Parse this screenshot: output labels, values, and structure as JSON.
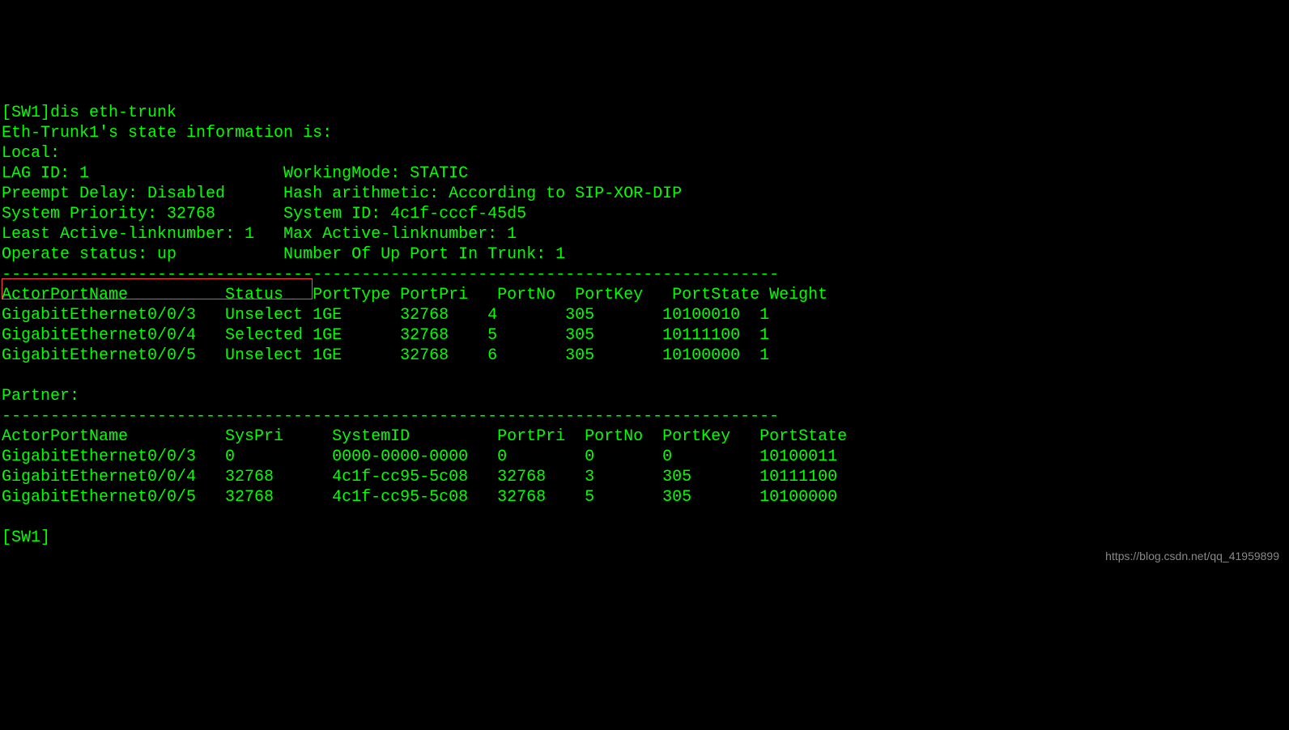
{
  "prompt_line": "[SW1]dis eth-trunk",
  "header_line": "Eth-Trunk1's state information is:",
  "local_label": "Local:",
  "info_lines": {
    "line1": "LAG ID: 1                    WorkingMode: STATIC",
    "line2": "Preempt Delay: Disabled      Hash arithmetic: According to SIP-XOR-DIP",
    "line3": "System Priority: 32768       System ID: 4c1f-cccf-45d5",
    "line4": "Least Active-linknumber: 1   Max Active-linknumber: 1",
    "line5": "Operate status: up           Number Of Up Port In Trunk: 1"
  },
  "separator": "--------------------------------------------------------------------------------",
  "local_table": {
    "header": "ActorPortName          Status   PortType PortPri   PortNo  PortKey   PortState Weight",
    "rows": [
      "GigabitEthernet0/0/3   Unselect 1GE      32768    4       305       10100010  1",
      "GigabitEthernet0/0/4   Selected 1GE      32768    5       305       10111100  1",
      "GigabitEthernet0/0/5   Unselect 1GE      32768    6       305       10100000  1"
    ]
  },
  "partner_label": "Partner:",
  "partner_table": {
    "header": "ActorPortName          SysPri     SystemID         PortPri  PortNo  PortKey   PortState",
    "rows": [
      "GigabitEthernet0/0/3   0          0000-0000-0000   0        0       0         10100011",
      "GigabitEthernet0/0/4   32768      4c1f-cc95-5c08   32768    3       305       10111100",
      "GigabitEthernet0/0/5   32768      4c1f-cc95-5c08   32768    5       305       10100000"
    ]
  },
  "final_prompt": "[SW1]",
  "watermark": "https://blog.csdn.net/qq_41959899",
  "highlight": {
    "text_covered": "GigabitEthernet0/0/4   Selected"
  }
}
